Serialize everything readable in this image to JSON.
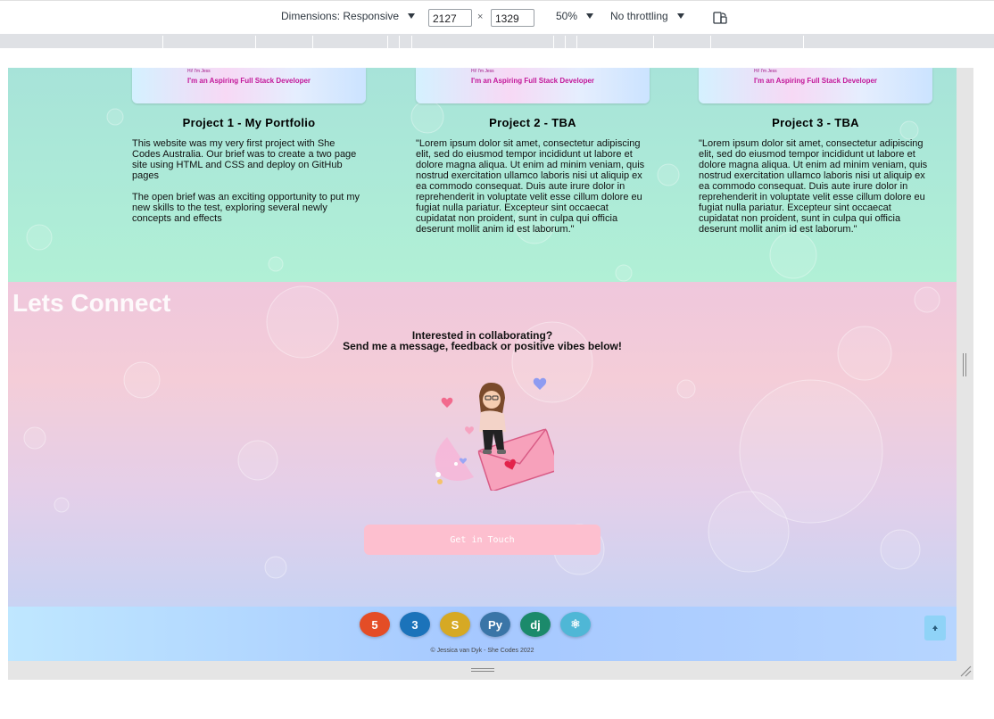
{
  "devtools": {
    "dimensions_label": "Dimensions: Responsive",
    "width_value": "2127",
    "times": "×",
    "height_value": "1329",
    "zoom": "50%",
    "throttling": "No throttling",
    "rotate_icon": "rotate-icon"
  },
  "projects": [
    {
      "thumb_hi": "Hi! I'm Jess",
      "thumb_tagline": "I'm an Aspiring Full Stack Developer",
      "title": "Project 1 - My Portfolio",
      "paragraphs": [
        "This website was my very first project with She Codes Australia. Our brief was to create a two page site using HTML and CSS and deploy on GitHub pages",
        "The open brief was an exciting opportunity to put my new skills to the test, exploring several newly concepts and effects"
      ]
    },
    {
      "thumb_hi": "Hi! I'm Jess",
      "thumb_tagline": "I'm an Aspiring Full Stack Developer",
      "title": "Project 2 - TBA",
      "paragraphs": [
        "\"Lorem ipsum dolor sit amet, consectetur adipiscing elit, sed do eiusmod tempor incididunt ut labore et dolore magna aliqua. Ut enim ad minim veniam, quis nostrud exercitation ullamco laboris nisi ut aliquip ex ea commodo consequat. Duis aute irure dolor in reprehenderit in voluptate velit esse cillum dolore eu fugiat nulla pariatur. Excepteur sint occaecat cupidatat non proident, sunt in culpa qui officia deserunt mollit anim id est laborum.\""
      ]
    },
    {
      "thumb_hi": "Hi! I'm Jess",
      "thumb_tagline": "I'm an Aspiring Full Stack Developer",
      "title": "Project 3 - TBA",
      "paragraphs": [
        "\"Lorem ipsum dolor sit amet, consectetur adipiscing elit, sed do eiusmod tempor incididunt ut labore et dolore magna aliqua. Ut enim ad minim veniam, quis nostrud exercitation ullamco laboris nisi ut aliquip ex ea commodo consequat. Duis aute irure dolor in reprehenderit in voluptate velit esse cillum dolore eu fugiat nulla pariatur. Excepteur sint occaecat cupidatat non proident, sunt in culpa qui officia deserunt mollit anim id est laborum.\""
      ]
    }
  ],
  "connect": {
    "heading": "Lets Connect",
    "line1": "Interested in collaborating?",
    "line2": "Send me a message, feedback or positive vibes below!",
    "illustration": "bitmoji-envelope-illustration",
    "cta_label": "Get in Touch"
  },
  "footer": {
    "tech_icons": [
      {
        "name": "html5-icon",
        "glyph": "5",
        "color": "#e44d26"
      },
      {
        "name": "css3-icon",
        "glyph": "3",
        "color": "#1b73ba"
      },
      {
        "name": "javascript-icon",
        "glyph": "S",
        "color": "#d6a924"
      },
      {
        "name": "python-icon",
        "glyph": "Py",
        "color": "#3a75a7"
      },
      {
        "name": "django-icon",
        "glyph": "dj",
        "color": "#1b8a6b"
      },
      {
        "name": "react-icon",
        "glyph": "⚛",
        "color": "#4fb7d6"
      }
    ],
    "copyright": "© Jessica van Dyk - She Codes 2022",
    "back_to_top_icon": "arrow-up-icon"
  },
  "colors": {
    "projects_bg": "#a7e3d9",
    "connect_bg": "#efc7dc",
    "cta_bg": "#fdbfcf",
    "footer_bg": "#a6c8ff",
    "top_button": "#8fd3f7"
  }
}
